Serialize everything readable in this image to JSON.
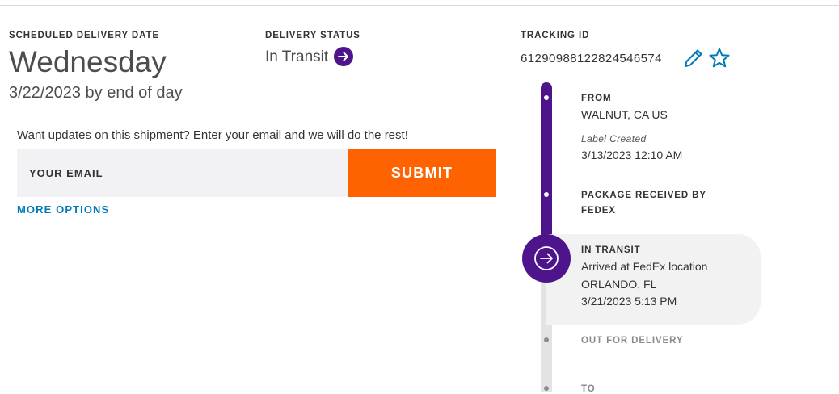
{
  "delivery": {
    "scheduled_label": "SCHEDULED DELIVERY DATE",
    "day": "Wednesday",
    "date_line": "3/22/2023 by end of day"
  },
  "status": {
    "label": "DELIVERY STATUS",
    "value": "In Transit",
    "icon": "arrow-right-circle-icon",
    "color": "#4d148c"
  },
  "tracking": {
    "label": "TRACKING ID",
    "number": "61290988122824546574",
    "edit_icon": "pencil-icon",
    "favorite_icon": "star-icon",
    "icon_color": "#007ab7"
  },
  "updates": {
    "prompt": "Want updates on this shipment? Enter your email and we will do the rest!",
    "email_placeholder": "YOUR EMAIL",
    "submit_label": "SUBMIT",
    "submit_color": "#ff6200",
    "more_options": "MORE OPTIONS"
  },
  "timeline": {
    "from_label": "FROM",
    "from_location": "WALNUT, CA US",
    "label_created_label": "Label Created",
    "label_created_time": "3/13/2023 12:10 AM",
    "received_line1": "PACKAGE RECEIVED BY",
    "received_line2": "FEDEX",
    "current": {
      "status": "IN TRANSIT",
      "detail": "Arrived at FedEx location",
      "location": "ORLANDO, FL",
      "time": "3/21/2023 5:13 PM"
    },
    "out_for_delivery": "OUT FOR DELIVERY",
    "to_label": "TO"
  }
}
